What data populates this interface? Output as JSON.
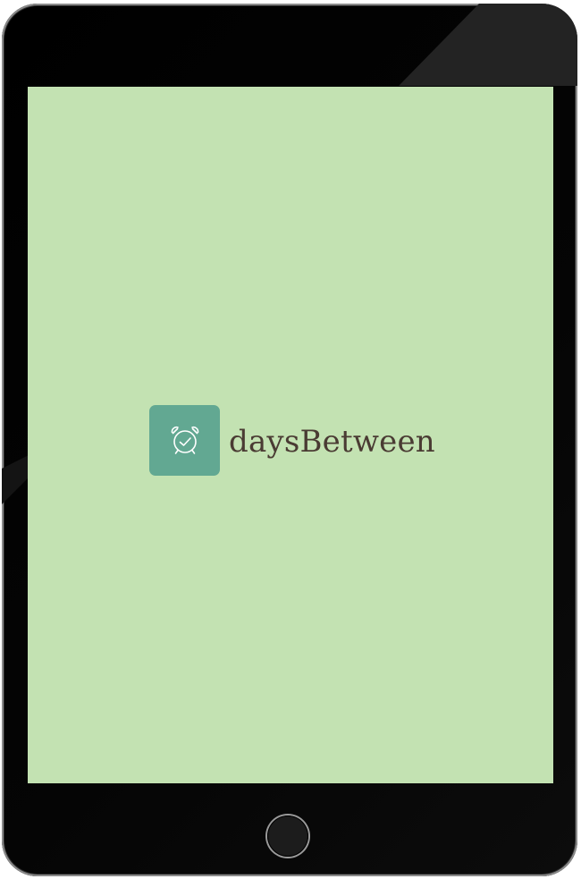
{
  "app": {
    "name": "daysBetween",
    "logo_icon": "alarm-clock-icon"
  },
  "colors": {
    "screen_background": "#c3e2b2",
    "logo_tile": "#62a892",
    "logo_icon_stroke": "#ffffff",
    "app_name_text": "#4a3b33",
    "device_body": "#000000"
  }
}
